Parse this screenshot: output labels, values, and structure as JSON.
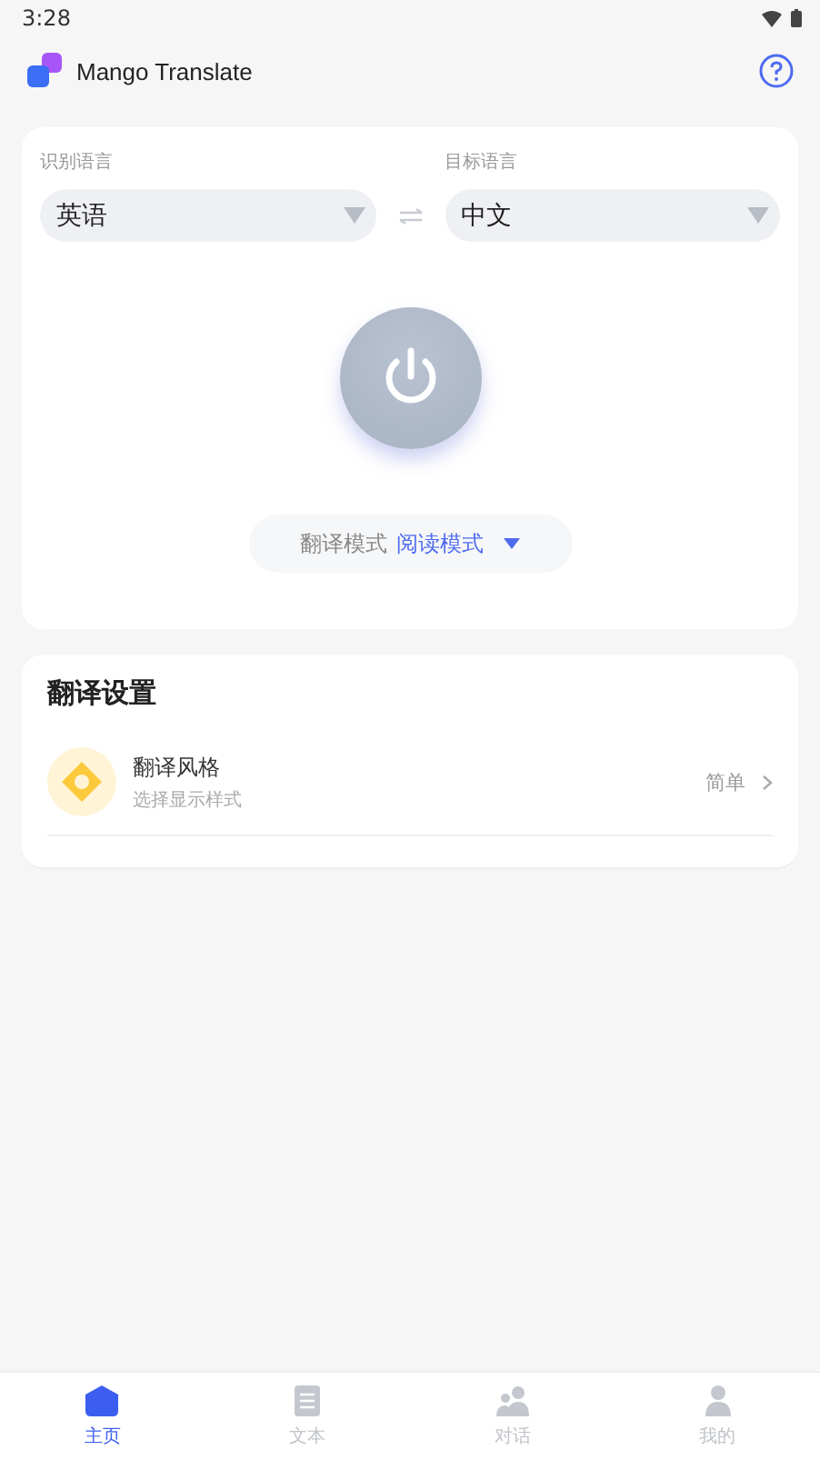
{
  "status_bar": {
    "time": "3:28"
  },
  "header": {
    "title": "Mango Translate"
  },
  "languages": {
    "source_label": "识别语言",
    "source": "英语",
    "target_label": "目标语言",
    "target": "中文"
  },
  "power": {
    "on": false
  },
  "mode": {
    "label": "翻译模式",
    "value": "阅读模式"
  },
  "settings": {
    "title": "翻译设置",
    "items": [
      {
        "title": "翻译风格",
        "subtitle": "选择显示样式",
        "value": "简单"
      }
    ]
  },
  "nav": [
    {
      "kind": "home",
      "label": "主页",
      "selected": true
    },
    {
      "kind": "text",
      "label": "文本",
      "selected": false
    },
    {
      "kind": "chat",
      "label": "对话",
      "selected": false
    },
    {
      "kind": "profile",
      "label": "我的",
      "selected": false
    }
  ]
}
